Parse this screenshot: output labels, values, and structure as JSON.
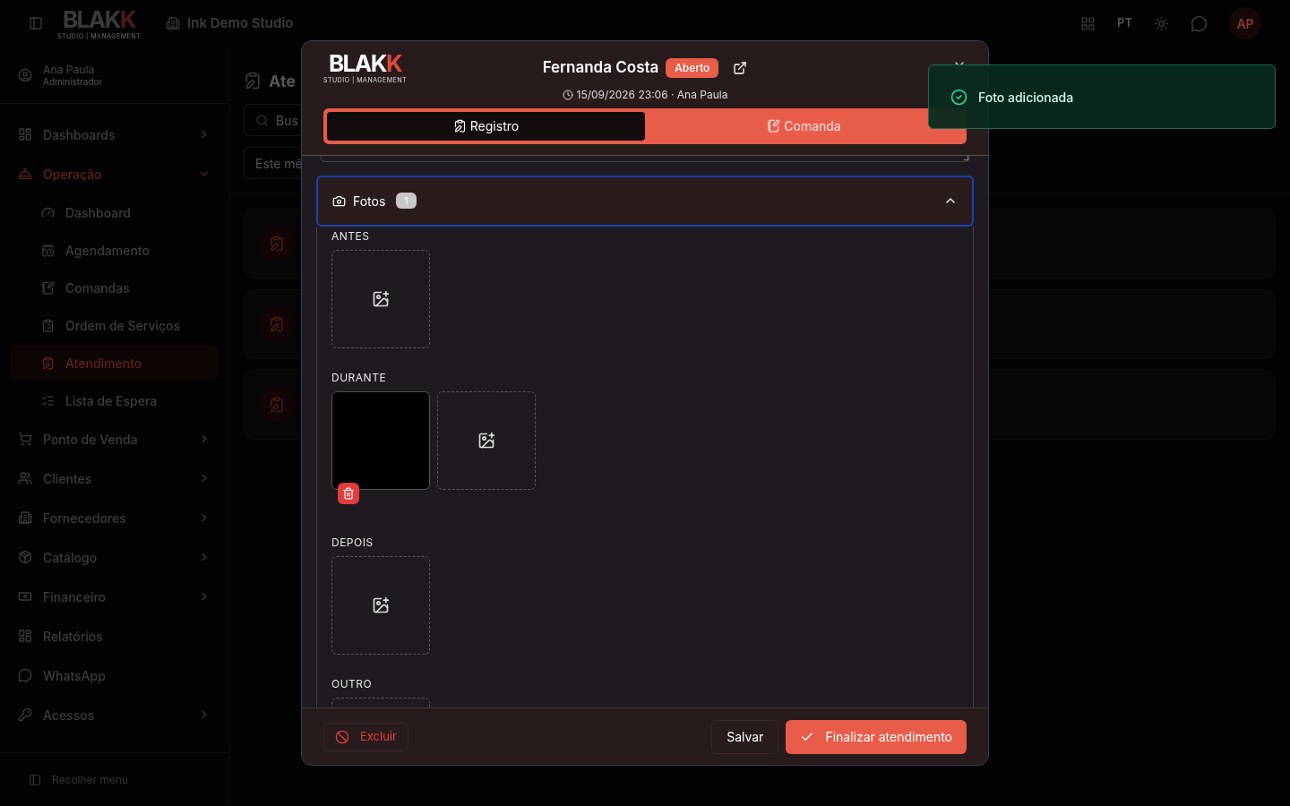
{
  "topbar": {
    "studio": "Ink Demo Studio",
    "language": "PT",
    "avatar": "AP",
    "logo": {
      "main": "BLAK",
      "accent": "K",
      "tagline": "STUDIO | MANAGEMENT"
    }
  },
  "user": {
    "name": "Ana Paula",
    "role": "Administrador"
  },
  "sidebar": {
    "items": [
      {
        "label": "Dashboards",
        "kind": "group",
        "expanded": false,
        "selected": false
      },
      {
        "label": "Operação",
        "kind": "group",
        "expanded": true,
        "selected": true,
        "children": [
          {
            "label": "Dashboard",
            "selected": false
          },
          {
            "label": "Agendamento",
            "selected": false
          },
          {
            "label": "Comandas",
            "selected": false
          },
          {
            "label": "Ordem de Serviços",
            "selected": false
          },
          {
            "label": "Atendimento",
            "selected": true
          },
          {
            "label": "Lista de Espera",
            "selected": false
          }
        ]
      },
      {
        "label": "Ponto de Venda",
        "kind": "group",
        "expanded": false,
        "selected": false
      },
      {
        "label": "Clientes",
        "kind": "group",
        "expanded": false,
        "selected": false
      },
      {
        "label": "Fornecedores",
        "kind": "group",
        "expanded": false,
        "selected": false
      },
      {
        "label": "Catálogo",
        "kind": "group",
        "expanded": false,
        "selected": false
      },
      {
        "label": "Financeiro",
        "kind": "group",
        "expanded": false,
        "selected": false
      },
      {
        "label": "Relatórios",
        "kind": "link",
        "selected": false
      },
      {
        "label": "WhatsApp",
        "kind": "link",
        "selected": false
      },
      {
        "label": "Acessos",
        "kind": "group",
        "expanded": false,
        "selected": false
      }
    ],
    "collapse": "Recolher menu"
  },
  "page": {
    "title": "Ate",
    "search": {
      "placeholder": "Bus"
    },
    "period": "Este mê"
  },
  "modal": {
    "logo": {
      "main": "BLAK",
      "accent": "K",
      "tagline": "STUDIO | MANAGEMENT"
    },
    "client": "Fernanda Costa",
    "status": "Aberto",
    "meta": "15/09/2026 23:06 · Ana Paula",
    "tabs": [
      {
        "label": "Registro",
        "selected": true
      },
      {
        "label": "Comanda",
        "selected": false
      }
    ],
    "photos": {
      "title": "Fotos",
      "count": "1",
      "expanded": true,
      "groups": [
        {
          "label": "ANTES",
          "items": [
            {
              "kind": "add"
            }
          ]
        },
        {
          "label": "DURANTE",
          "items": [
            {
              "kind": "photo"
            },
            {
              "kind": "add"
            }
          ]
        },
        {
          "label": "DEPOIS",
          "items": [
            {
              "kind": "add"
            }
          ]
        },
        {
          "label": "OUTRO",
          "items": [
            {
              "kind": "add"
            }
          ]
        }
      ]
    },
    "footer": {
      "delete": "Excluir",
      "save": "Salvar",
      "finish": "Finalizar atendimento"
    }
  },
  "toast": {
    "message": "Foto adicionada",
    "kind": "success"
  }
}
